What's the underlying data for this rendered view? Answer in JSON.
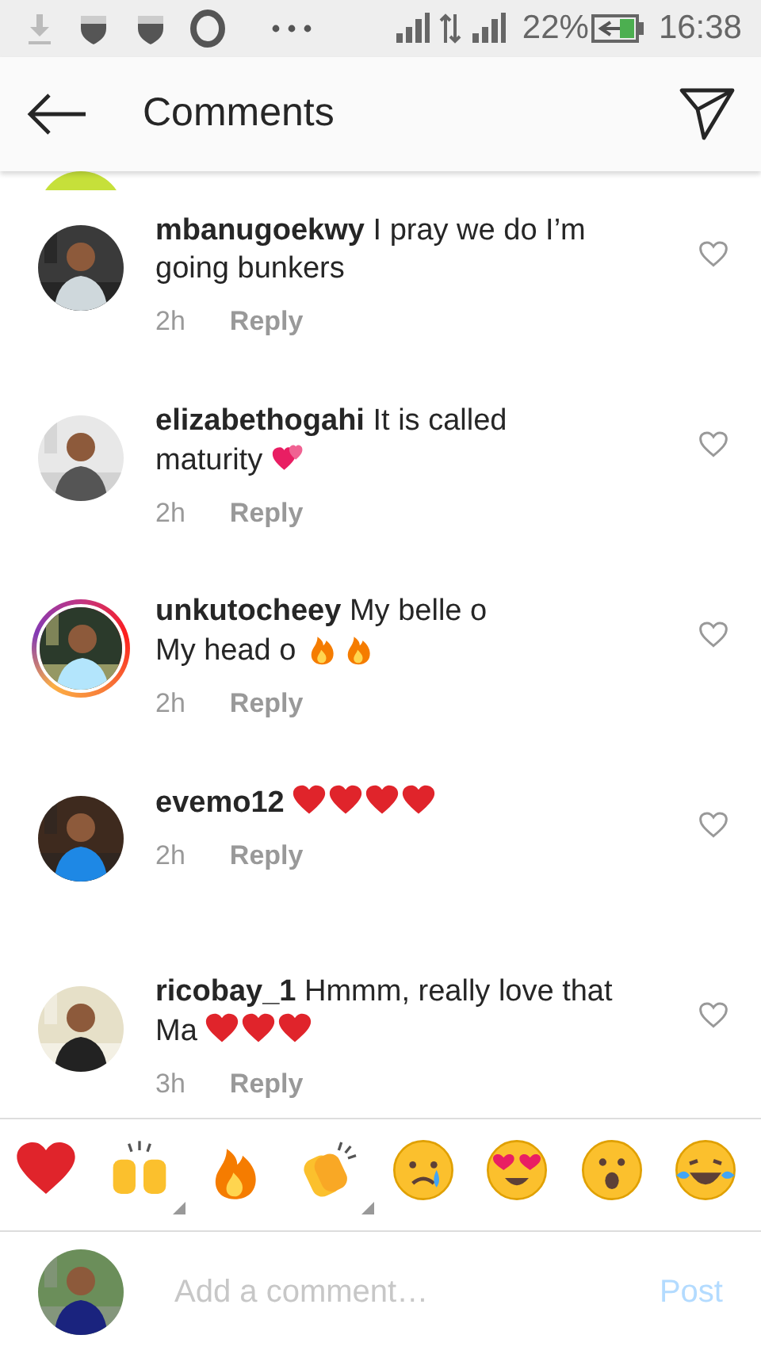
{
  "status_bar": {
    "battery": "22%",
    "time": "16:38"
  },
  "header": {
    "title": "Comments"
  },
  "comments": [
    {
      "lines": [
        {
          "text": "**mbanugoekwy** I pray we do I’m"
        },
        {
          "text": "going bunkers"
        }
      ],
      "time": "2h",
      "reply": "Reply",
      "story": false,
      "liked": false
    },
    {
      "lines": [
        {
          "text": "**elizabethogahi** It is called"
        },
        {
          "text": "maturity",
          "emoji": [
            {
              "kind": "two-hearts"
            }
          ]
        }
      ],
      "time": "2h",
      "reply": "Reply",
      "story": false,
      "liked": false
    },
    {
      "lines": [
        {
          "text": "**unkutocheey** My belle o"
        },
        {
          "text": "My head o",
          "emoji": [
            {
              "kind": "fire"
            },
            {
              "kind": "fire"
            }
          ]
        }
      ],
      "time": "2h",
      "reply": "Reply",
      "story": true,
      "liked": false
    },
    {
      "lines": [
        {
          "text": "**evemo12**",
          "emoji": [
            {
              "kind": "heart"
            },
            {
              "kind": "heart"
            },
            {
              "kind": "heart"
            },
            {
              "kind": "heart"
            }
          ]
        }
      ],
      "time": "2h",
      "reply": "Reply",
      "story": false,
      "liked": false
    },
    {
      "lines": [
        {
          "text": "**ricobay_1** Hmmm, really love that"
        },
        {
          "text": "Ma",
          "emoji": [
            {
              "kind": "heart"
            },
            {
              "kind": "heart"
            },
            {
              "kind": "heart"
            }
          ]
        }
      ],
      "time": "3h",
      "reply": "Reply",
      "story": false,
      "liked": false
    }
  ],
  "emoji_bar": [
    {
      "kind": "heart",
      "variants": false
    },
    {
      "kind": "raised-hands",
      "variants": true
    },
    {
      "kind": "fire",
      "variants": false
    },
    {
      "kind": "clap",
      "variants": true
    },
    {
      "kind": "crying",
      "variants": false
    },
    {
      "kind": "heart-eyes",
      "variants": false
    },
    {
      "kind": "surprised",
      "variants": false
    },
    {
      "kind": "laughing",
      "variants": false
    }
  ],
  "composer": {
    "placeholder": "Add a comment…",
    "post": "Post",
    "post_disabled": true
  }
}
